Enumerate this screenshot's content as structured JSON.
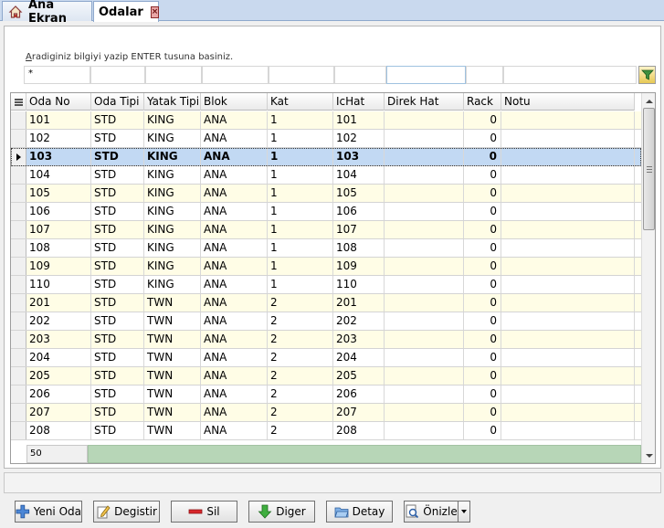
{
  "tabs": [
    {
      "label": "Ana Ekran",
      "icon": "home-icon"
    },
    {
      "label": "Odalar",
      "icon": "close-icon"
    }
  ],
  "search": {
    "hint": "Aradiginiz bilgiyi yazip ENTER tusuna basiniz.",
    "hint_first_letter": "A",
    "hint_rest": "radiginiz bilgiyi yazip ENTER tusuna basiniz.",
    "filter_value": "*"
  },
  "grid": {
    "columns": [
      "Oda No",
      "Oda Tipi",
      "Yatak Tipi",
      "Blok",
      "Kat",
      "IcHat",
      "Direk Hat",
      "Rack",
      "Notu"
    ],
    "selected_row": "103",
    "rows": [
      {
        "oda_no": "101",
        "oda_tipi": "STD",
        "yatak_tipi": "KING",
        "blok": "ANA",
        "kat": "1",
        "ichat": "101",
        "direk_hat": "",
        "rack": "0",
        "notu": ""
      },
      {
        "oda_no": "102",
        "oda_tipi": "STD",
        "yatak_tipi": "KING",
        "blok": "ANA",
        "kat": "1",
        "ichat": "102",
        "direk_hat": "",
        "rack": "0",
        "notu": ""
      },
      {
        "oda_no": "103",
        "oda_tipi": "STD",
        "yatak_tipi": "KING",
        "blok": "ANA",
        "kat": "1",
        "ichat": "103",
        "direk_hat": "",
        "rack": "0",
        "notu": ""
      },
      {
        "oda_no": "104",
        "oda_tipi": "STD",
        "yatak_tipi": "KING",
        "blok": "ANA",
        "kat": "1",
        "ichat": "104",
        "direk_hat": "",
        "rack": "0",
        "notu": ""
      },
      {
        "oda_no": "105",
        "oda_tipi": "STD",
        "yatak_tipi": "KING",
        "blok": "ANA",
        "kat": "1",
        "ichat": "105",
        "direk_hat": "",
        "rack": "0",
        "notu": ""
      },
      {
        "oda_no": "106",
        "oda_tipi": "STD",
        "yatak_tipi": "KING",
        "blok": "ANA",
        "kat": "1",
        "ichat": "106",
        "direk_hat": "",
        "rack": "0",
        "notu": ""
      },
      {
        "oda_no": "107",
        "oda_tipi": "STD",
        "yatak_tipi": "KING",
        "blok": "ANA",
        "kat": "1",
        "ichat": "107",
        "direk_hat": "",
        "rack": "0",
        "notu": ""
      },
      {
        "oda_no": "108",
        "oda_tipi": "STD",
        "yatak_tipi": "KING",
        "blok": "ANA",
        "kat": "1",
        "ichat": "108",
        "direk_hat": "",
        "rack": "0",
        "notu": ""
      },
      {
        "oda_no": "109",
        "oda_tipi": "STD",
        "yatak_tipi": "KING",
        "blok": "ANA",
        "kat": "1",
        "ichat": "109",
        "direk_hat": "",
        "rack": "0",
        "notu": ""
      },
      {
        "oda_no": "110",
        "oda_tipi": "STD",
        "yatak_tipi": "KING",
        "blok": "ANA",
        "kat": "1",
        "ichat": "110",
        "direk_hat": "",
        "rack": "0",
        "notu": ""
      },
      {
        "oda_no": "201",
        "oda_tipi": "STD",
        "yatak_tipi": "TWN",
        "blok": "ANA",
        "kat": "2",
        "ichat": "201",
        "direk_hat": "",
        "rack": "0",
        "notu": ""
      },
      {
        "oda_no": "202",
        "oda_tipi": "STD",
        "yatak_tipi": "TWN",
        "blok": "ANA",
        "kat": "2",
        "ichat": "202",
        "direk_hat": "",
        "rack": "0",
        "notu": ""
      },
      {
        "oda_no": "203",
        "oda_tipi": "STD",
        "yatak_tipi": "TWN",
        "blok": "ANA",
        "kat": "2",
        "ichat": "203",
        "direk_hat": "",
        "rack": "0",
        "notu": ""
      },
      {
        "oda_no": "204",
        "oda_tipi": "STD",
        "yatak_tipi": "TWN",
        "blok": "ANA",
        "kat": "2",
        "ichat": "204",
        "direk_hat": "",
        "rack": "0",
        "notu": ""
      },
      {
        "oda_no": "205",
        "oda_tipi": "STD",
        "yatak_tipi": "TWN",
        "blok": "ANA",
        "kat": "2",
        "ichat": "205",
        "direk_hat": "",
        "rack": "0",
        "notu": ""
      },
      {
        "oda_no": "206",
        "oda_tipi": "STD",
        "yatak_tipi": "TWN",
        "blok": "ANA",
        "kat": "2",
        "ichat": "206",
        "direk_hat": "",
        "rack": "0",
        "notu": ""
      },
      {
        "oda_no": "207",
        "oda_tipi": "STD",
        "yatak_tipi": "TWN",
        "blok": "ANA",
        "kat": "2",
        "ichat": "207",
        "direk_hat": "",
        "rack": "0",
        "notu": ""
      },
      {
        "oda_no": "208",
        "oda_tipi": "STD",
        "yatak_tipi": "TWN",
        "blok": "ANA",
        "kat": "2",
        "ichat": "208",
        "direk_hat": "",
        "rack": "0",
        "notu": ""
      }
    ],
    "footer_count": "50"
  },
  "buttons": [
    {
      "key": "yeni-oda",
      "label": "Yeni Oda",
      "icon": "plus-icon"
    },
    {
      "key": "degistir",
      "label": "Degistir",
      "icon": "edit-icon"
    },
    {
      "key": "sil",
      "label": "Sil",
      "icon": "delete-icon"
    },
    {
      "key": "diger",
      "label": "Diger",
      "icon": "arrow-down-icon"
    },
    {
      "key": "detay",
      "label": "Detay",
      "icon": "folder-icon"
    },
    {
      "key": "onizle",
      "label": "Önizle",
      "icon": "preview-icon"
    }
  ],
  "colors": {
    "row_alt": "#fffde6",
    "row_selected": "#c2d9f3",
    "footer_bar": "#b7d6b7",
    "tab_strip": "#c9d9ee"
  }
}
